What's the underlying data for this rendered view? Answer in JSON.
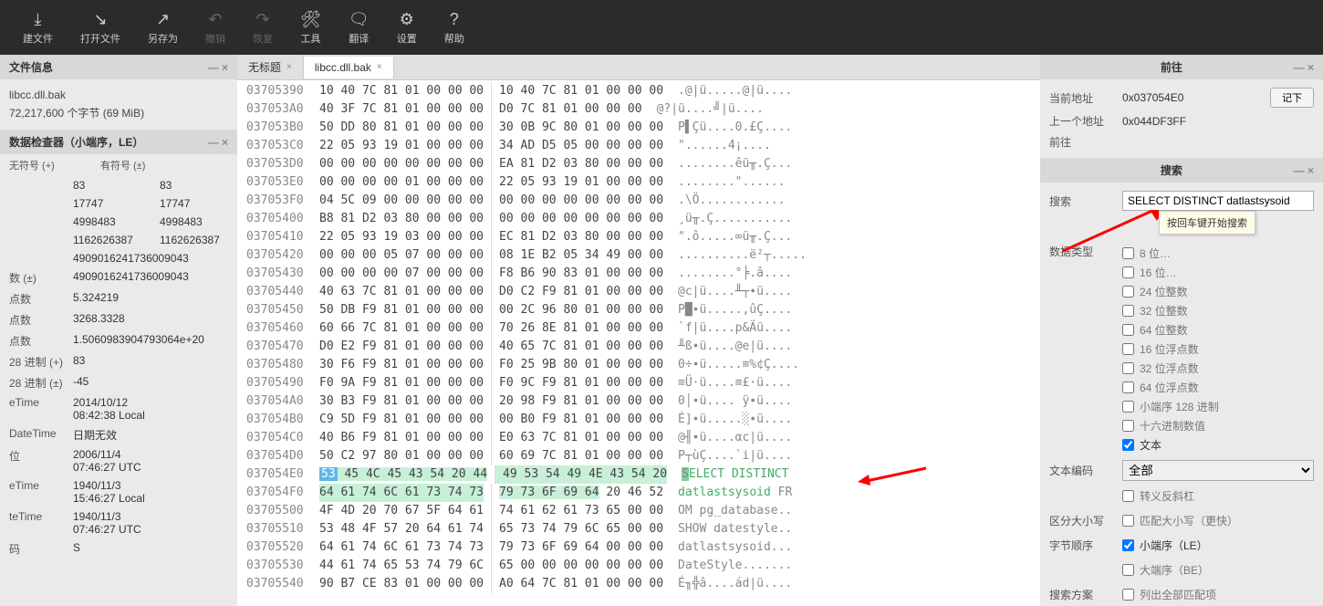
{
  "toolbar": [
    {
      "icon": "⤓",
      "label": "建文件"
    },
    {
      "icon": "↘",
      "label": "打开文件"
    },
    {
      "icon": "↗",
      "label": "另存为"
    },
    {
      "icon": "↶",
      "label": "撤销",
      "dim": true
    },
    {
      "icon": "↷",
      "label": "恢复",
      "dim": true
    },
    {
      "icon": "🛠",
      "label": "工具"
    },
    {
      "icon": "🗨",
      "label": "翻译"
    },
    {
      "icon": "⚙",
      "label": "设置"
    },
    {
      "icon": "?",
      "label": "帮助"
    }
  ],
  "fileinfo": {
    "title": "文件信息",
    "name": "libcc.dll.bak",
    "size": "72,217,600 个字节 (69 MiB)"
  },
  "inspector": {
    "title": "数据检查器（小端序，LE）",
    "cols": [
      "无符号 (+)",
      "有符号 (±)"
    ],
    "rows": [
      {
        "l": "",
        "v1": "83",
        "v2": "83"
      },
      {
        "l": "",
        "v1": "17747",
        "v2": "17747"
      },
      {
        "l": "",
        "v1": "4998483",
        "v2": "4998483"
      },
      {
        "l": "",
        "v1": "1162626387",
        "v2": "1162626387"
      },
      {
        "l": "",
        "v1": "4909016241736009043",
        "v2": ""
      },
      {
        "l": "数 (±)",
        "v1": "4909016241736009043",
        "v2": ""
      },
      {
        "l": "点数",
        "v1": "5.324219",
        "v2": ""
      },
      {
        "l": "点数",
        "v1": "3268.3328",
        "v2": ""
      },
      {
        "l": "点数",
        "v1": "1.5060983904793064e+20",
        "v2": ""
      },
      {
        "l": "28 进制 (+)",
        "v1": "83",
        "v2": ""
      },
      {
        "l": "28 进制 (±)",
        "v1": "-45",
        "v2": ""
      },
      {
        "l": "eTime",
        "v1": "2014/10/12 08:42:38 Local",
        "v2": ""
      },
      {
        "l": "DateTime",
        "v1": "日期无效",
        "v2": ""
      },
      {
        "l": "位",
        "v1": "2006/11/4 07:46:27 UTC",
        "v2": ""
      },
      {
        "l": "eTime",
        "v1": "1940/11/3 15:46:27 Local",
        "v2": ""
      },
      {
        "l": "teTime",
        "v1": "1940/11/3 07:46:27 UTC",
        "v2": ""
      },
      {
        "l": "码",
        "v1": "S",
        "v2": ""
      }
    ]
  },
  "tabs": [
    {
      "label": "无标题",
      "active": false
    },
    {
      "label": "libcc.dll.bak",
      "active": true
    }
  ],
  "hex": [
    {
      "a": "03705390",
      "b1": "10 40 7C 81 01 00 00 00",
      "b2": "10 40 7C 81 01 00 00 00",
      "t": ".@|ü.....@|ü...."
    },
    {
      "a": "037053A0",
      "b1": "40 3F 7C 81 01 00 00 00",
      "b2": "D0 7C 81 01 00 00 00",
      "t": "@?|ü....╝|ü...."
    },
    {
      "a": "037053B0",
      "b1": "50 DD 80 81 01 00 00 00",
      "b2": "30 0B 9C 80 01 00 00 00",
      "t": "P▌Çü....0.£Ç...."
    },
    {
      "a": "037053C0",
      "b1": "22 05 93 19 01 00 00 00",
      "b2": "34 AD D5 05 00 00 00 00",
      "t": "\"......4¡...."
    },
    {
      "a": "037053D0",
      "b1": "00 00 00 00 00 00 00 00",
      "b2": "EA 81 D2 03 80 00 00 00",
      "t": "........êü╥.Ç..."
    },
    {
      "a": "037053E0",
      "b1": "00 00 00 00 01 00 00 00",
      "b2": "22 05 93 19 01 00 00 00",
      "t": "........\"......"
    },
    {
      "a": "037053F0",
      "b1": "04 5C 09 00 00 00 00 00",
      "b2": "00 00 00 00 00 00 00 00",
      "t": ".\\Ö............"
    },
    {
      "a": "03705400",
      "b1": "B8 81 D2 03 80 00 00 00",
      "b2": "00 00 00 00 00 00 00 00",
      "t": "¸ü╥.Ç..........."
    },
    {
      "a": "03705410",
      "b1": "22 05 93 19 03 00 00 00",
      "b2": "EC 81 D2 03 80 00 00 00",
      "t": "\".ô.....∞ü╥.Ç..."
    },
    {
      "a": "03705420",
      "b1": "00 00 00 05 07 00 00 00",
      "b2": "08 1E B2 05 34 49 00 00",
      "t": "..........ë²┬....."
    },
    {
      "a": "03705430",
      "b1": "00 00 00 00 07 00 00 00",
      "b2": "F8 B6 90 83 01 00 00 00",
      "t": "........°╞.â...."
    },
    {
      "a": "03705440",
      "b1": "40 63 7C 81 01 00 00 00",
      "b2": "D0 C2 F9 81 01 00 00 00",
      "t": "@c|ü....╨┬∙ü...."
    },
    {
      "a": "03705450",
      "b1": "50 DB F9 81 01 00 00 00",
      "b2": "00 2C 96 80 01 00 00 00",
      "t": "P█∙ü.....,ûÇ...."
    },
    {
      "a": "03705460",
      "b1": "60 66 7C 81 01 00 00 00",
      "b2": "70 26 8E 81 01 00 00 00",
      "t": "`f|ü....p&Äü...."
    },
    {
      "a": "03705470",
      "b1": "D0 E2 F9 81 01 00 00 00",
      "b2": "40 65 7C 81 01 00 00 00",
      "t": "╨ß∙ü....@e|ü...."
    },
    {
      "a": "03705480",
      "b1": "30 F6 F9 81 01 00 00 00",
      "b2": "F0 25 9B 80 01 00 00 00",
      "t": "0÷∙ü.....≡%¢Ç...."
    },
    {
      "a": "03705490",
      "b1": "F0 9A F9 81 01 00 00 00",
      "b2": "F0 9C F9 81 01 00 00 00",
      "t": "≡Ü·ü....≡£·ü...."
    },
    {
      "a": "037054A0",
      "b1": "30 B3 F9 81 01 00 00 00",
      "b2": "20 98 F9 81 01 00 00 00",
      "t": "0│∙ü.... ÿ∙ü...."
    },
    {
      "a": "037054B0",
      "b1": "C9 5D F9 81 01 00 00 00",
      "b2": "00 B0 F9 81 01 00 00 00",
      "t": "É]∙ü.....░∙ü...."
    },
    {
      "a": "037054C0",
      "b1": "40 B6 F9 81 01 00 00 00",
      "b2": "E0 63 7C 81 01 00 00 00",
      "t": "@╢∙ü....αc|ü...."
    },
    {
      "a": "037054D0",
      "b1": "50 C2 97 80 01 00 00 00",
      "b2": "60 69 7C 81 01 00 00 00",
      "t": "P┬ùÇ....`i|ü...."
    },
    {
      "a": "037054E0",
      "b1": "53 45 4C 45 43 54 20 44",
      "b2": "49 53 54 49 4E 43 54 20",
      "t": "SELECT DISTINCT ",
      "hl": true,
      "first": true
    },
    {
      "a": "037054F0",
      "b1": "64 61 74 6C 61 73 74 73",
      "b2": "79 73 6F 69 64",
      "b3": " 20 46 52",
      "t1": "datlastsysoid",
      "t2": " FR",
      "hl": true
    },
    {
      "a": "03705500",
      "b1": "4F 4D 20 70 67 5F 64 61",
      "b2": "74 61 62 61 73 65 00 00",
      "t": "OM pg_database.."
    },
    {
      "a": "03705510",
      "b1": "53 48 4F 57 20 64 61 74",
      "b2": "65 73 74 79 6C 65 00 00",
      "t": "SHOW datestyle.."
    },
    {
      "a": "03705520",
      "b1": "64 61 74 6C 61 73 74 73",
      "b2": "79 73 6F 69 64 00 00 00",
      "t": "datlastsysoid..."
    },
    {
      "a": "03705530",
      "b1": "44 61 74 65 53 74 79 6C",
      "b2": "65 00 00 00 00 00 00 00",
      "t": "DateStyle......."
    },
    {
      "a": "03705540",
      "b1": "90 B7 CE 83 01 00 00 00",
      "b2": "A0 64 7C 81 01 00 00 00",
      "t": "É╖╬â....ád|ü...."
    }
  ],
  "goto": {
    "title": "前往",
    "cur_lbl": "当前地址",
    "cur_val": "0x037054E0",
    "btn": "记下",
    "prev_lbl": "上一个地址",
    "prev_val": "0x044DF3FF",
    "go_lbl": "前往"
  },
  "search": {
    "title": "搜索",
    "search_lbl": "搜索",
    "input_val": "SELECT DISTINCT datlastsysoid",
    "tooltip": "按回车键开始搜索",
    "dtype_lbl": "数据类型",
    "checks": [
      {
        "l": "8 位…",
        "on": false
      },
      {
        "l": "16 位…",
        "on": false
      },
      {
        "l": "24 位整数",
        "on": false
      },
      {
        "l": "32 位整数",
        "on": false
      },
      {
        "l": "64 位整数",
        "on": false
      },
      {
        "l": "16 位浮点数",
        "on": false
      },
      {
        "l": "32 位浮点数",
        "on": false
      },
      {
        "l": "64 位浮点数",
        "on": false
      },
      {
        "l": "小端序 128 进制",
        "on": false
      },
      {
        "l": "十六进制数值",
        "on": false
      },
      {
        "l": "文本",
        "on": true
      }
    ],
    "enc_lbl": "文本编码",
    "enc_val": "全部",
    "esc_lbl": "转义反斜杠",
    "case_lbl": "区分大小写",
    "case_opt": "匹配大小写（更快）",
    "endian_lbl": "字节顺序",
    "endian1": "小端序（LE）",
    "endian2": "大端序（BE）",
    "scheme_lbl": "搜索方案",
    "scheme_opt": "列出全部匹配项"
  }
}
